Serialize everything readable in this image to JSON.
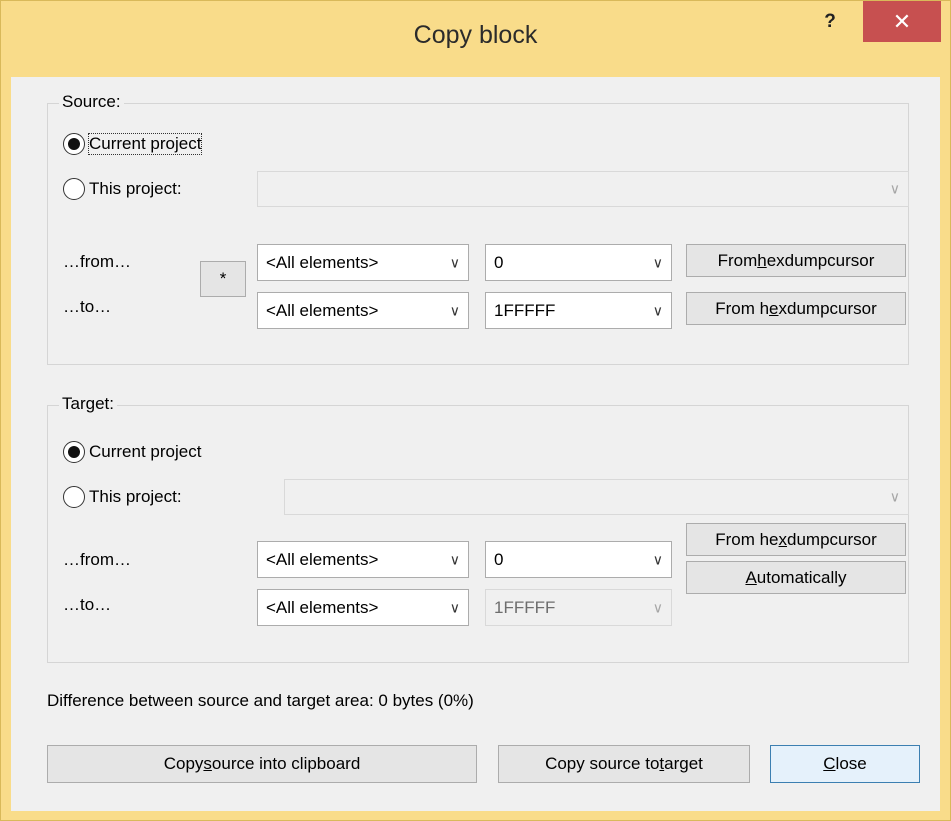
{
  "window": {
    "title": "Copy block",
    "help_label": "?",
    "close_label": "✕"
  },
  "source": {
    "group_label": "Source:",
    "radio_current": "Current project",
    "radio_this": "This project:",
    "from_label": "…from…",
    "to_label": "…to…",
    "star_label": "*",
    "from_elements": "<All elements>",
    "to_elements": "<All elements>",
    "from_offset": "0",
    "to_offset": "1FFFFF",
    "from_cursor_btn": {
      "pre": "From ",
      "ul": "h",
      "post": "exdumpcursor"
    },
    "to_cursor_btn": {
      "pre": "From h",
      "ul": "e",
      "post": "xdumpcursor"
    }
  },
  "target": {
    "group_label": "Target:",
    "radio_current": "Current project",
    "radio_this": "This project:",
    "from_label": "…from…",
    "to_label": "…to…",
    "from_elements": "<All elements>",
    "to_elements": "<All elements>",
    "from_offset": "0",
    "to_offset": "1FFFFF",
    "from_cursor_btn": {
      "pre": "From he",
      "ul": "x",
      "post": "dumpcursor"
    },
    "auto_btn": {
      "pre": "",
      "ul": "A",
      "post": "utomatically"
    }
  },
  "difference_text": "Difference between source and target area: 0 bytes (0%)",
  "buttons": {
    "copy_clipboard": {
      "pre": "Copy ",
      "ul": "s",
      "post": "ource into clipboard"
    },
    "copy_target": {
      "pre": "Copy source to ",
      "ul": "t",
      "post": "arget"
    },
    "close": {
      "pre": "",
      "ul": "C",
      "post": "lose"
    }
  },
  "icons": {
    "dropdown": "chevron-down-icon"
  }
}
